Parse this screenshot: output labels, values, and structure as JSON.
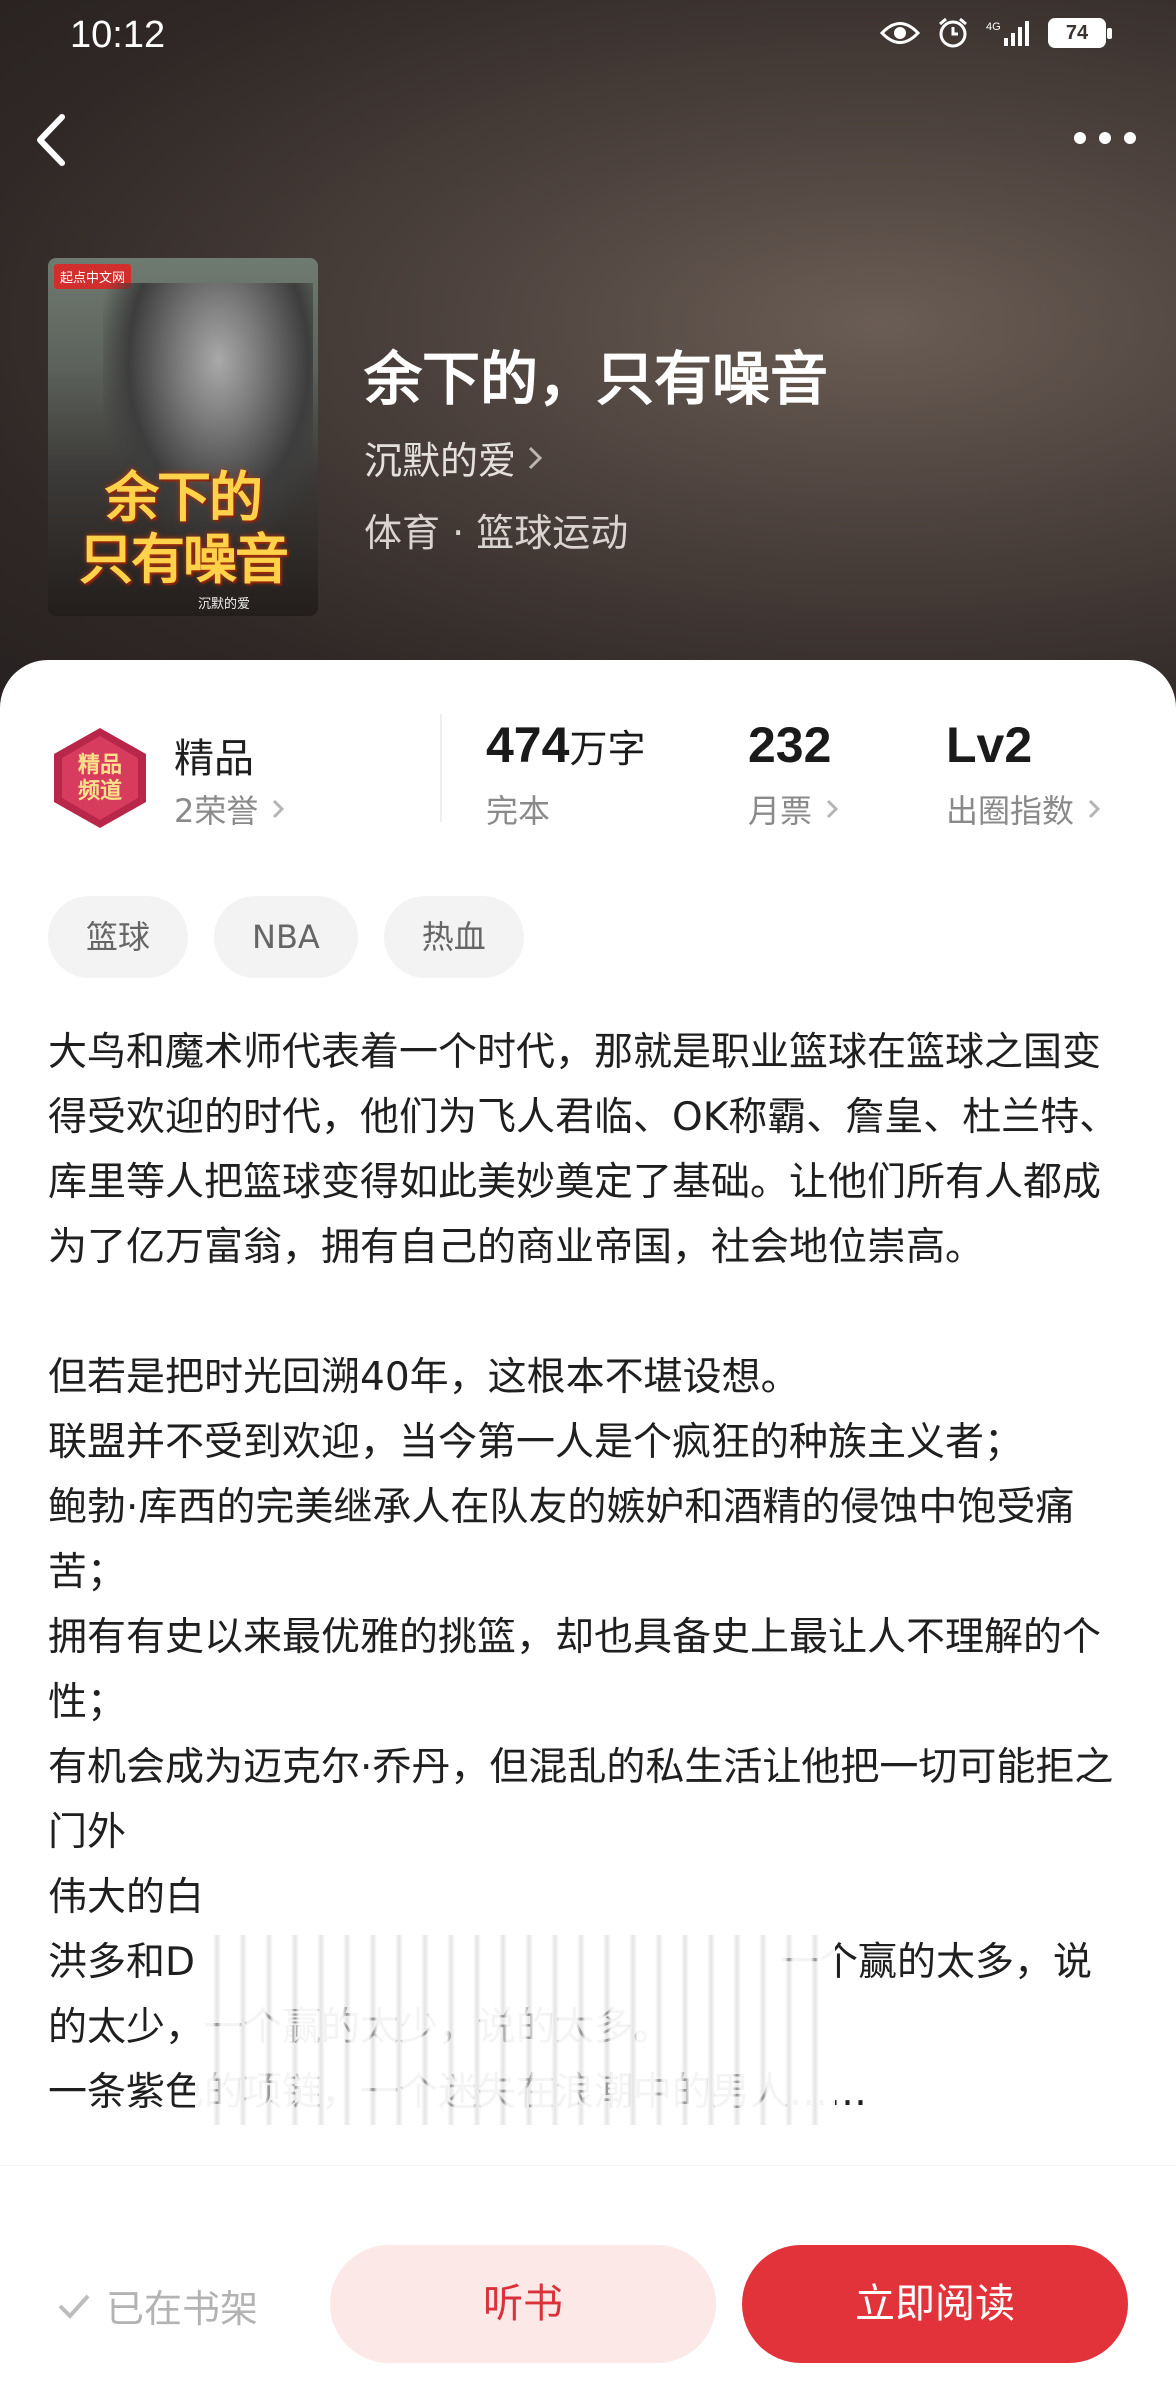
{
  "status_bar": {
    "time": "10:12",
    "network": "4G",
    "battery": "74"
  },
  "book": {
    "title": "余下的，只有噪音",
    "author": "沉默的爱",
    "category": "体育 · 篮球运动",
    "cover": {
      "publisher": "起点中文网",
      "title_lines": [
        "余下的",
        "只有噪音"
      ],
      "author": "沉默的爱"
    }
  },
  "badge": {
    "icon_text": "精品频道",
    "title": "精品",
    "subtitle": "2荣誉"
  },
  "stats": [
    {
      "value": "474",
      "unit": "万字",
      "label": "完本"
    },
    {
      "value": "232",
      "unit": "",
      "label": "月票"
    },
    {
      "value": "Lv2",
      "unit": "",
      "label": "出圈指数"
    }
  ],
  "tags": [
    "篮球",
    "NBA",
    "热血"
  ],
  "intro": "大鸟和魔术师代表着一个时代，那就是职业篮球在篮球之国变得受欢迎的时代，他们为飞人君临、OK称霸、詹皇、杜兰特、库里等人把篮球变得如此美妙奠定了基础。让他们所有人都成为了亿万富翁，拥有自己的商业帝国，社会地位崇高。\n\n但若是把时光回溯40年，这根本不堪设想。\n联盟并不受到欢迎，当今第一人是个疯狂的种族主义者；\n鲍勃·库西的完美继承人在队友的嫉妒和酒精的侵蚀中饱受痛苦；\n拥有有史以来最优雅的挑篮，却也具备史上最让人不理解的个性；\n有机会成为迈克尔·乔丹，但混乱的私生活让他把一切可能拒之门外\n伟大的白\n洪多和D　　　　　　　　　　　　　　　一个赢的太多，说的太少，一个赢的太少，说的太多。\n一条紫色的项链，一个迷失在浪潮中的男人……",
  "actions": {
    "shelf_label": "已在书架",
    "listen_label": "听书",
    "read_label": "立即阅读"
  },
  "colors": {
    "accent": "#e3333a",
    "accent_light": "#fde8e8",
    "hero_bg": "#3b3330"
  }
}
